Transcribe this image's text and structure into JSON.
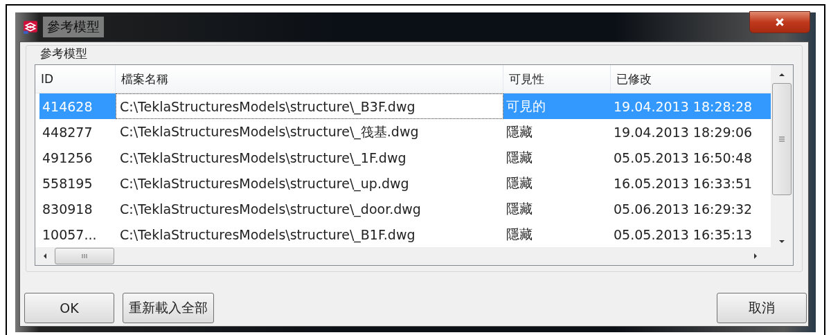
{
  "window": {
    "title": "參考模型"
  },
  "group": {
    "legend": "參考模型"
  },
  "table": {
    "columns": [
      "ID",
      "檔案名稱",
      "可見性",
      "已修改"
    ],
    "rows": [
      {
        "id": "414628",
        "file": "C:\\TeklaStructuresModels\\structure\\_B3F.dwg",
        "visibility": "可見的",
        "modified": "19.04.2013 18:28:28",
        "selected": true
      },
      {
        "id": "448277",
        "file": "C:\\TeklaStructuresModels\\structure\\_筏基.dwg",
        "visibility": "隱藏",
        "modified": "19.04.2013 18:29:06",
        "selected": false
      },
      {
        "id": "491256",
        "file": "C:\\TeklaStructuresModels\\structure\\_1F.dwg",
        "visibility": "隱藏",
        "modified": "05.05.2013 16:50:48",
        "selected": false
      },
      {
        "id": "558195",
        "file": "C:\\TeklaStructuresModels\\structure\\_up.dwg",
        "visibility": "隱藏",
        "modified": "16.05.2013 16:33:51",
        "selected": false
      },
      {
        "id": "830918",
        "file": "C:\\TeklaStructuresModels\\structure\\_door.dwg",
        "visibility": "隱藏",
        "modified": "05.06.2013 16:29:32",
        "selected": false
      },
      {
        "id": "10057...",
        "file": "C:\\TeklaStructuresModels\\structure\\_B1F.dwg",
        "visibility": "隱藏",
        "modified": "05.05.2013 16:35:13",
        "selected": false
      }
    ]
  },
  "buttons": {
    "ok": "OK",
    "reload": "重新載入全部",
    "cancel": "取消"
  }
}
